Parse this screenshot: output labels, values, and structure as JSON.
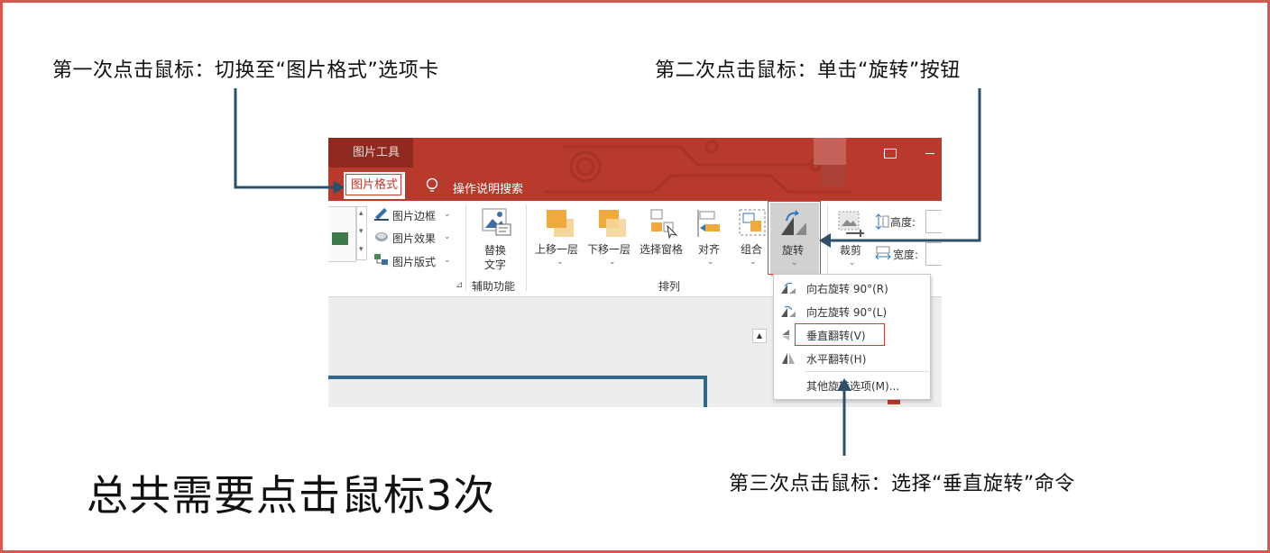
{
  "annotations": {
    "step1": "第一次点击鼠标：切换至“图片格式”选项卡",
    "step2": "第二次点击鼠标：单击“旋转”按钮",
    "step3": "第三次点击鼠标：选择“垂直旋转”命令",
    "total": "总共需要点击鼠标3次"
  },
  "titlebar": {
    "tool_group": "图片工具",
    "active_tab": "图片格式",
    "tell_me": "操作说明搜索"
  },
  "ribbon": {
    "border_label": "图片边框",
    "effects_label": "图片效果",
    "layout_label": "图片版式",
    "alt_text_line1": "替换",
    "alt_text_line2": "文字",
    "accessibility_group": "辅助功能",
    "bring_forward": "上移一层",
    "send_backward": "下移一层",
    "selection_pane": "选择窗格",
    "align": "对齐",
    "group": "组合",
    "rotate": "旋转",
    "arrange_group": "排列",
    "crop": "裁剪",
    "height_label": "高度:",
    "width_label": "宽度:"
  },
  "rotate_menu": {
    "items": [
      {
        "label": "向右旋转 90°(R)",
        "icon": "rotate-right-icon"
      },
      {
        "label": "向左旋转 90°(L)",
        "icon": "rotate-left-icon"
      },
      {
        "label": "垂直翻转(V)",
        "icon": "flip-vertical-icon"
      },
      {
        "label": "水平翻转(H)",
        "icon": "flip-horizontal-icon"
      },
      {
        "label": "其他旋转选项(M)...",
        "icon": ""
      }
    ]
  },
  "colors": {
    "frame_border": "#d4584e",
    "ribbon_red": "#b83a2c",
    "highlight_red": "#d23a3a",
    "arrow_blue": "#2e4f68"
  }
}
